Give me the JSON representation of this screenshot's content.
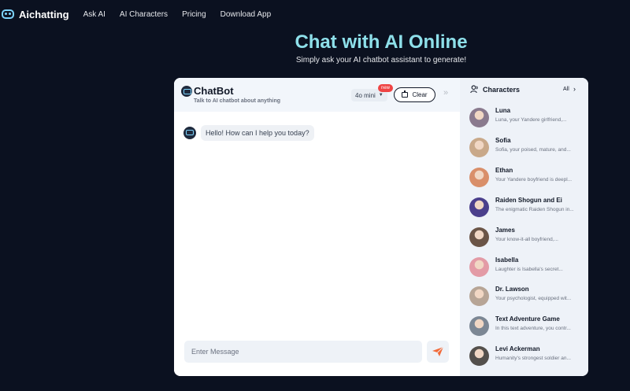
{
  "nav": {
    "brand": "Aichatting",
    "links": [
      "Ask AI",
      "AI Characters",
      "Pricing",
      "Download App"
    ]
  },
  "hero": {
    "title": "Chat with AI Online",
    "subtitle": "Simply ask your AI chatbot assistant to generate!"
  },
  "chat": {
    "title": "ChatBot",
    "description": "Talk to AI chatbot about anything",
    "model": "4o mini",
    "badge": "new",
    "clear_label": "Clear",
    "messages": [
      {
        "from": "bot",
        "text": "Hello! How can I help you today?"
      }
    ],
    "input_placeholder": "Enter Message"
  },
  "characters": {
    "title": "Characters",
    "all_label": "All",
    "items": [
      {
        "name": "Luna",
        "desc": "Luna, your Yandere girlfriend,...",
        "color": "#8a7a8e"
      },
      {
        "name": "Sofia",
        "desc": "Sofia, your poised, mature, and...",
        "color": "#c9a98a"
      },
      {
        "name": "Ethan",
        "desc": "Your Yandere boyfriend is deepl...",
        "color": "#d98f6a"
      },
      {
        "name": "Raiden Shogun and Ei",
        "desc": "The enigmatic Raiden Shogun in...",
        "color": "#4b3f8c"
      },
      {
        "name": "James",
        "desc": "Your know-it-all boyfriend,...",
        "color": "#6b5547"
      },
      {
        "name": "Isabella",
        "desc": "Laughter is Isabella's secret...",
        "color": "#e39ba6"
      },
      {
        "name": "Dr. Lawson",
        "desc": "Your psychologist, equipped wit...",
        "color": "#b7a596"
      },
      {
        "name": "Text Adventure Game",
        "desc": "In this text adventure, you contr...",
        "color": "#7c8794"
      },
      {
        "name": "Levi Ackerman",
        "desc": "Humanity's strongest soldier an...",
        "color": "#54504c"
      }
    ]
  },
  "colors": {
    "background": "#0b1120",
    "accent": "#8ee0ea",
    "send": "#f26b3a"
  }
}
